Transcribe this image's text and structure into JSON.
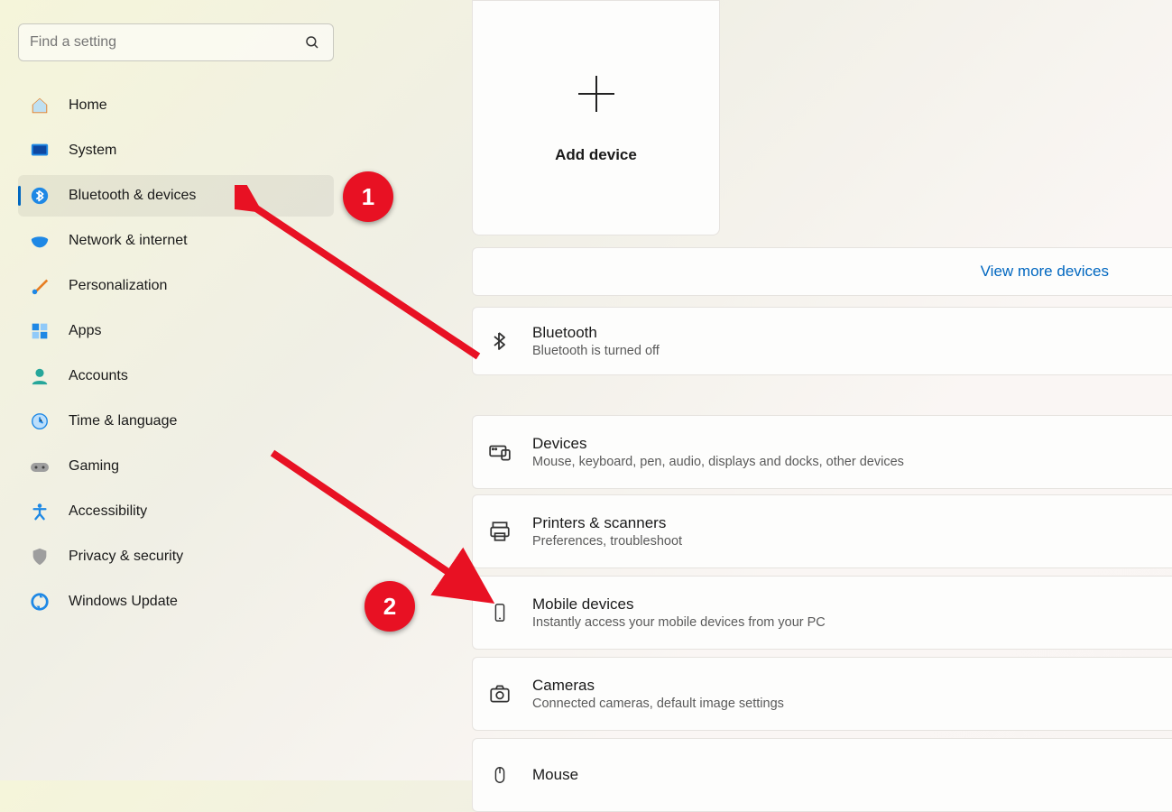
{
  "search": {
    "placeholder": "Find a setting"
  },
  "sidebar": {
    "items": [
      {
        "label": "Home"
      },
      {
        "label": "System"
      },
      {
        "label": "Bluetooth & devices"
      },
      {
        "label": "Network & internet"
      },
      {
        "label": "Personalization"
      },
      {
        "label": "Apps"
      },
      {
        "label": "Accounts"
      },
      {
        "label": "Time & language"
      },
      {
        "label": "Gaming"
      },
      {
        "label": "Accessibility"
      },
      {
        "label": "Privacy & security"
      },
      {
        "label": "Windows Update"
      }
    ],
    "selected_index": 2
  },
  "add_device": {
    "label": "Add device"
  },
  "view_more": {
    "label": "View more devices"
  },
  "rows": {
    "bluetooth": {
      "title": "Bluetooth",
      "sub": "Bluetooth is turned off"
    },
    "devices": {
      "title": "Devices",
      "sub": "Mouse, keyboard, pen, audio, displays and docks, other devices"
    },
    "printers": {
      "title": "Printers & scanners",
      "sub": "Preferences, troubleshoot"
    },
    "mobile": {
      "title": "Mobile devices",
      "sub": "Instantly access your mobile devices from your PC"
    },
    "cameras": {
      "title": "Cameras",
      "sub": "Connected cameras, default image settings"
    },
    "mouse": {
      "title": "Mouse"
    }
  },
  "annotations": {
    "badge1": "1",
    "badge2": "2"
  }
}
